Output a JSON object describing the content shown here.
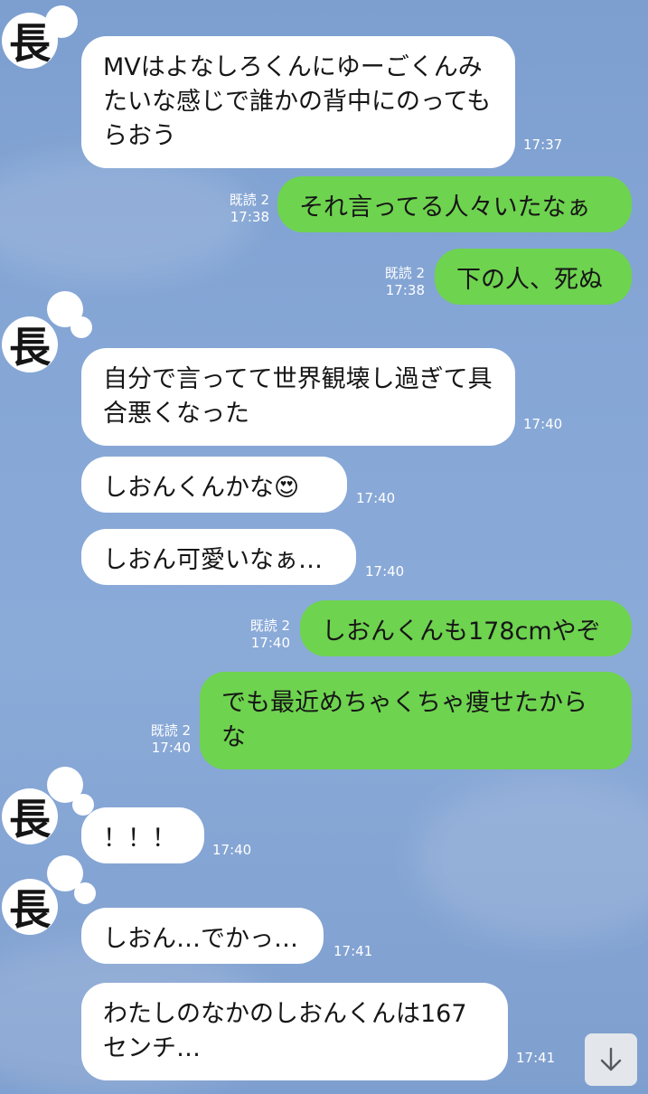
{
  "avatar_glyph": "長",
  "messages": [
    {
      "side": "in",
      "text": "MVはよなしろくんにゆーごくんみたいな感じで誰かの背中にのってもらおう",
      "time": "17:37"
    },
    {
      "side": "out",
      "text": "それ言ってる人々いたなぁ",
      "read": "既読 2",
      "time": "17:38"
    },
    {
      "side": "out",
      "text": "下の人、死ぬ",
      "read": "既読 2",
      "time": "17:38"
    },
    {
      "side": "in",
      "text": "自分で言ってて世界観壊し過ぎて具合悪くなった",
      "time": "17:40"
    },
    {
      "side": "in",
      "text": "しおんくんかな😍",
      "time": "17:40"
    },
    {
      "side": "in",
      "text": "しおん可愛いなぁ…",
      "time": "17:40"
    },
    {
      "side": "out",
      "text": "しおんくんも178cmやぞ",
      "read": "既読 2",
      "time": "17:40"
    },
    {
      "side": "out",
      "text": "でも最近めちゃくちゃ痩せたからな",
      "read": "既読 2",
      "time": "17:40"
    },
    {
      "side": "in",
      "text": "！！！",
      "time": "17:40"
    },
    {
      "side": "in",
      "text": "しおん…でかっ…",
      "time": "17:41"
    },
    {
      "side": "in",
      "text": "わたしのなかのしおんくんは167センチ…",
      "time": "17:41"
    }
  ],
  "colors": {
    "background": "#86a7d6",
    "outgoing_bubble": "#6ed34f",
    "incoming_bubble": "#ffffff"
  },
  "icons": {
    "scroll_down": "arrow-down-icon"
  }
}
